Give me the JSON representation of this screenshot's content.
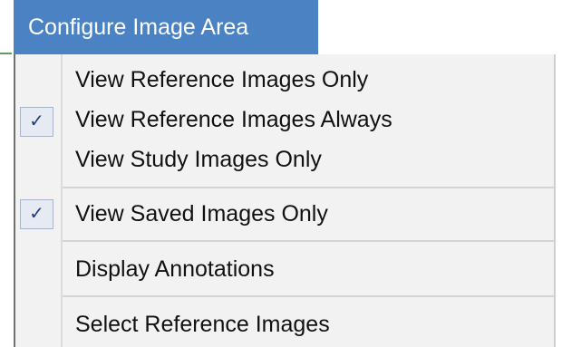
{
  "menu": {
    "title": "Configure Image Area",
    "items": [
      {
        "label": "View Reference Images Only",
        "checked": false
      },
      {
        "label": "View Reference Images Always",
        "checked": true
      },
      {
        "label": "View Study Images Only",
        "checked": false
      },
      {
        "label": "View Saved Images Only",
        "checked": true
      },
      {
        "label": "Display Annotations",
        "checked": false
      },
      {
        "label": "Select Reference Images",
        "checked": false
      }
    ],
    "check_glyph": "✓"
  },
  "colors": {
    "header_background": "#4a82c4",
    "header_text": "#ffffff",
    "menu_background": "#f2f2f2",
    "check_box_background": "#e5eaf3",
    "check_mark": "#1f3f7a"
  }
}
